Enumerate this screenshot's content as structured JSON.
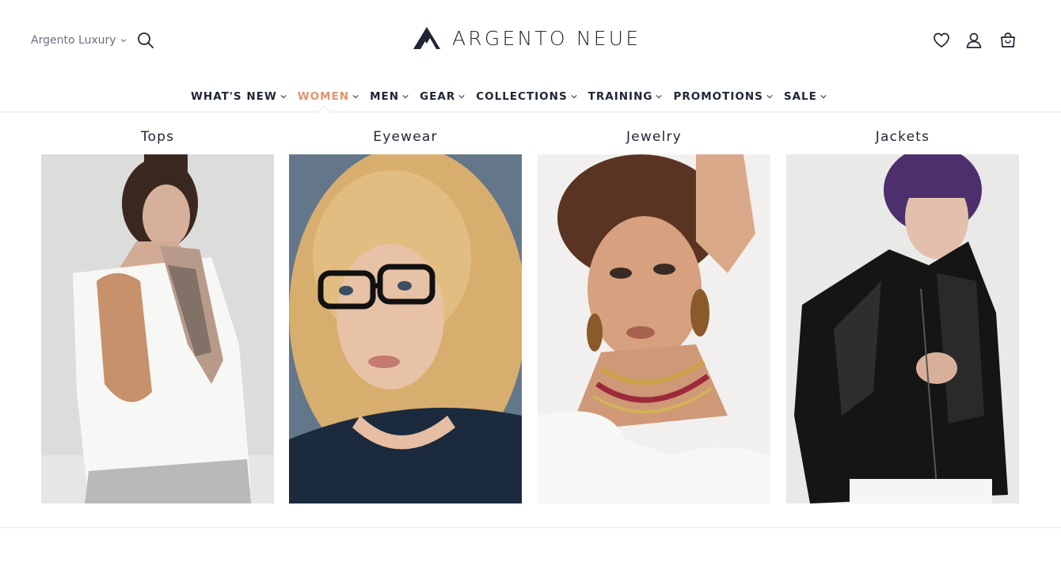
{
  "header": {
    "store_switcher_label": "Argento Luxury",
    "logo_text": "ARGENTO NEUE"
  },
  "nav": {
    "items": [
      {
        "label": "WHAT'S NEW"
      },
      {
        "label": "WOMEN",
        "active": true
      },
      {
        "label": "MEN"
      },
      {
        "label": "GEAR"
      },
      {
        "label": "COLLECTIONS"
      },
      {
        "label": "TRAINING"
      },
      {
        "label": "PROMOTIONS"
      },
      {
        "label": "SALE"
      }
    ]
  },
  "megamenu": {
    "categories": [
      {
        "label": "Tops"
      },
      {
        "label": "Eyewear"
      },
      {
        "label": "Jewelry"
      },
      {
        "label": "Jackets"
      }
    ]
  },
  "colors": {
    "accent": "#e0946a",
    "text": "#1f2533",
    "muted": "#6b7080",
    "divider": "#e4e6ea"
  },
  "icons": [
    "search-icon",
    "heart-icon",
    "user-icon",
    "shopping-bag-icon",
    "chevron-down-icon",
    "logo-icon"
  ]
}
